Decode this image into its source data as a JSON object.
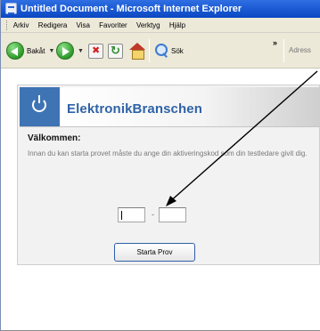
{
  "window": {
    "title": "Untitled Document - Microsoft Internet Explorer"
  },
  "menu": {
    "items": [
      "Arkiv",
      "Redigera",
      "Visa",
      "Favoriter",
      "Verktyg",
      "Hjälp"
    ]
  },
  "toolbar": {
    "back_label": "Bakåt",
    "search_label": "Sök",
    "more_label": "»",
    "address_label": "Adress"
  },
  "page": {
    "brand": "ElektronikBranschen",
    "welcome": "Välkommen:",
    "description": "Innan du kan starta provet måste du ange din aktiveringskod som din testledare givit dig.",
    "code_separator": "-",
    "code_part1": "",
    "code_part2": "",
    "start_button": "Starta Prov"
  },
  "colors": {
    "brand_blue": "#2f63a8",
    "logo_bg": "#3f74b4",
    "titlebar": "#0b47c2"
  },
  "icons": [
    "ie-app-icon",
    "back-icon",
    "forward-icon",
    "stop-icon",
    "refresh-icon",
    "home-icon",
    "search-icon",
    "power-icon"
  ]
}
